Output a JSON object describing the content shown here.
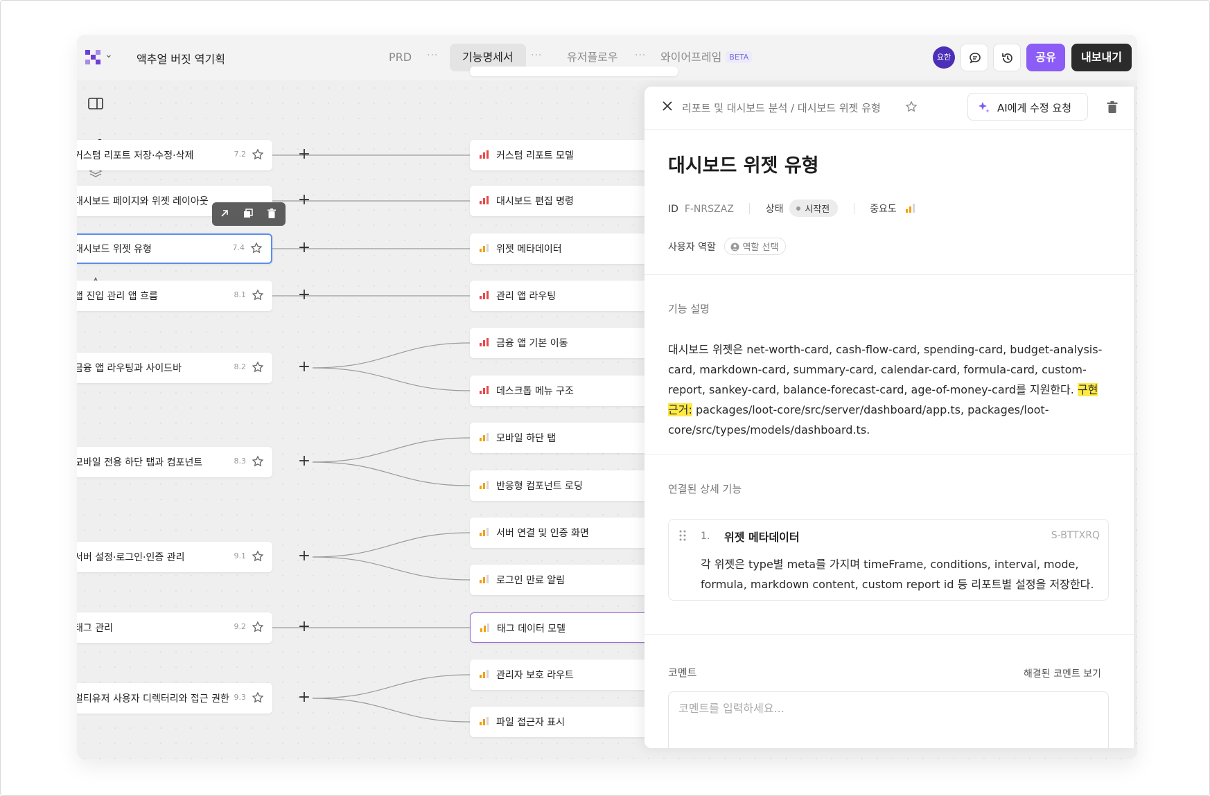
{
  "header": {
    "project_title": "액추얼 버짓 역기획",
    "tabs": [
      {
        "label": "PRD"
      },
      {
        "label": "기능명세서"
      },
      {
        "label": "유저플로우"
      },
      {
        "label": "와이어프레임"
      }
    ],
    "beta_badge": "BETA",
    "avatar_text": "요한",
    "share_label": "공유",
    "export_label": "내보내기"
  },
  "features": [
    {
      "label": "커스텀 리포트 저장·수정·삭제",
      "num": "7.2"
    },
    {
      "label": "대시보드 페이지와 위젯 레이아웃",
      "num": ""
    },
    {
      "label": "대시보드 위젯 유형",
      "num": "7.4"
    },
    {
      "label": "앱 진입 관리 앱 흐름",
      "num": "8.1"
    },
    {
      "label": "금융 앱 라우팅과 사이드바",
      "num": "8.2"
    },
    {
      "label": "모바일 전용 하단 탭과 컴포넌트",
      "num": "8.3"
    },
    {
      "label": "서버 설정·로그인·인증 관리",
      "num": "9.1"
    },
    {
      "label": "태그 관리",
      "num": "9.2"
    },
    {
      "label": "멀티유저 사용자 디렉터리와 접근 권한",
      "num": "9.3"
    }
  ],
  "subfeatures": [
    {
      "label": "커스텀 리포트 모델",
      "color": "#e5484d"
    },
    {
      "label": "대시보드 편집 명령",
      "color": "#e5484d"
    },
    {
      "label": "위젯 메타데이터",
      "color": "#f59e0b"
    },
    {
      "label": "관리 앱 라우팅",
      "color": "#e5484d"
    },
    {
      "label": "금융 앱 기본 이동",
      "color": "#e5484d"
    },
    {
      "label": "데스크톱 메뉴 구조",
      "color": "#e5484d"
    },
    {
      "label": "모바일 하단 탭",
      "color": "#f59e0b"
    },
    {
      "label": "반응형 컴포넌트 로딩",
      "color": "#f59e0b"
    },
    {
      "label": "서버 연결 및 인증 화면",
      "color": "#f59e0b"
    },
    {
      "label": "로그인 만료 알림",
      "color": "#f59e0b"
    },
    {
      "label": "태그 데이터 모델",
      "color": "#f59e0b"
    },
    {
      "label": "관리자 보호 라우트",
      "color": "#f59e0b"
    },
    {
      "label": "파일 접근자 표시",
      "color": "#f59e0b"
    }
  ],
  "panel": {
    "breadcrumb": "리포트 및 대시보드 분석 / 대시보드 위젯 유형",
    "ai_button": "AI에게 수정 요청",
    "title": "대시보드 위젯 유형",
    "id_label": "ID",
    "id_value": "F-NRSZAZ",
    "status_label": "상태",
    "status_value": "시작전",
    "importance_label": "중요도",
    "role_label": "사용자 역할",
    "role_placeholder": "역할 선택",
    "desc_title": "기능 설명",
    "desc_text": "대시보드 위젯은 net-worth-card, cash-flow-card, spending-card, budget-analysis-card, markdown-card, summary-card, calendar-card, formula-card, custom-report, sankey-card, balance-forecast-card, age-of-money-card를 지원한다.",
    "desc_highlight": "구현 근거:",
    "desc_tail": "packages/loot-core/src/server/dashboard/app.ts, packages/loot-core/src/types/models/dashboard.ts.",
    "linked_title": "연결된 상세 기능",
    "linked": {
      "index": "1.",
      "name": "위젯 메타데이터",
      "code": "S-BTTXRQ",
      "body": "각 위젯은 type별 meta를 가지며 timeFrame, conditions, interval, mode, formula, markdown content, custom report id 등 리포트별 설정을 저장한다."
    },
    "comment_title": "코멘트",
    "resolved_link": "해결된 코멘트 보기",
    "comment_placeholder": "코멘트를 입력하세요..."
  },
  "colors": {
    "accent": "#8b5cf6",
    "selected_border": "#5b8def",
    "high_priority": "#e5484d",
    "mid_priority": "#f59e0b"
  }
}
